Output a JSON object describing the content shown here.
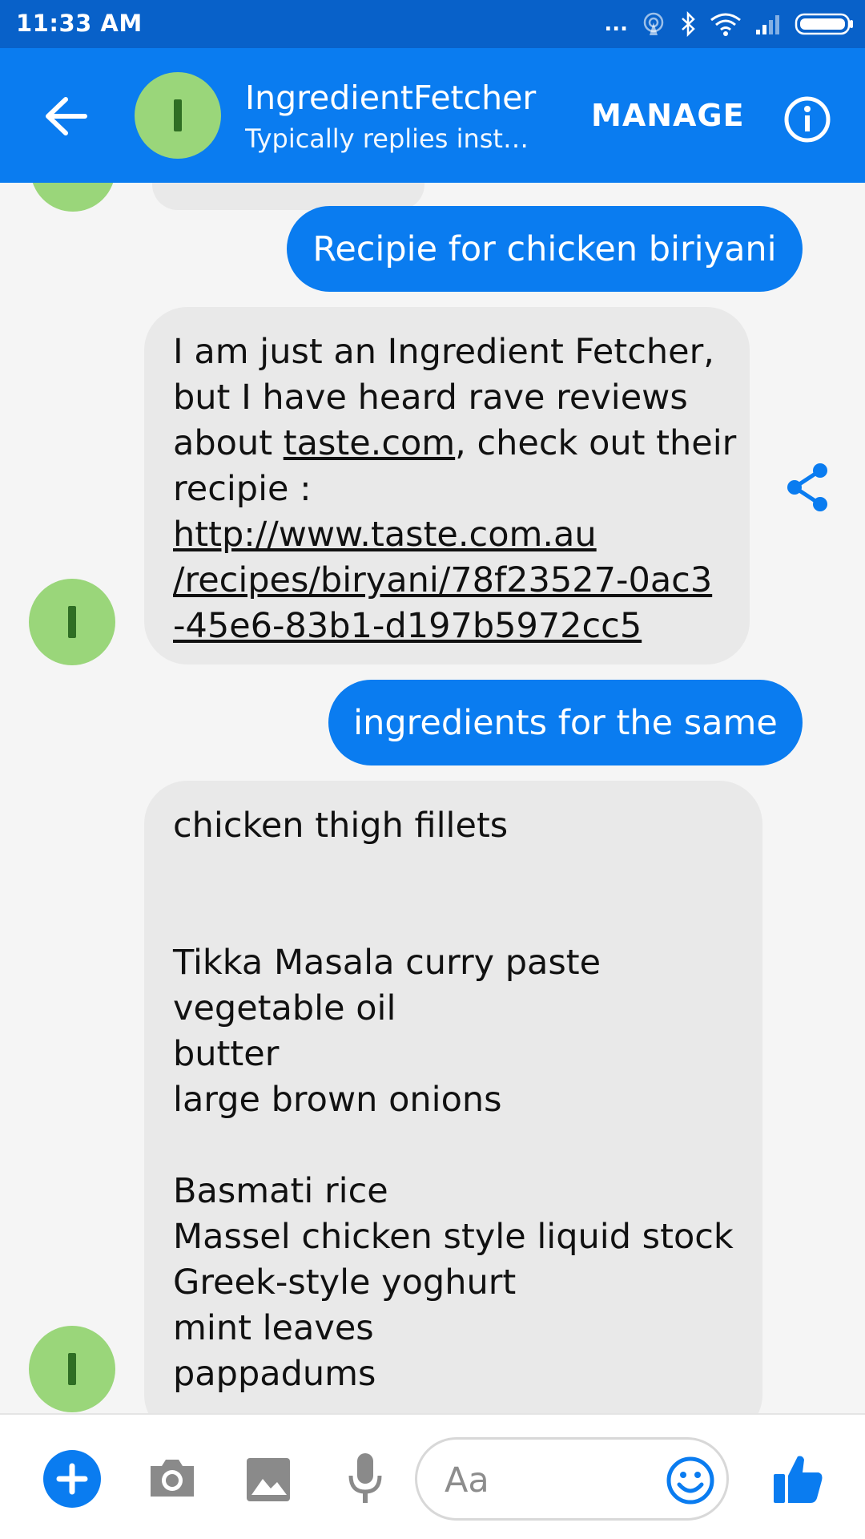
{
  "status_bar": {
    "time": "11:33 AM",
    "dots": "..."
  },
  "header": {
    "title": "IngredientFetcher",
    "subtitle": "Typically replies instantly",
    "manage_label": "MANAGE"
  },
  "messages": {
    "m1": {
      "text": "Recipie for chicken biriyani"
    },
    "m2": {
      "line1": "I am just an Ingredient Fetcher,",
      "line2": "but I have heard rave reviews",
      "line3_prefix": "about ",
      "line3_link": "taste.com",
      "line3_suffix": ", check out their",
      "line4": "recipie :",
      "url1": "http://www.taste.com.au",
      "url2": "/recipes/biryani/78f23527-0ac3",
      "url3": "-45e6-83b1-d197b5972cc5"
    },
    "m3": {
      "text": "ingredients for the same"
    },
    "m4": {
      "i1": "chicken thigh fillets",
      "i2": "Tikka Masala curry paste",
      "i3": "vegetable oil",
      "i4": "butter",
      "i5": "large brown onions",
      "i6": "Basmati rice",
      "i7": "Massel chicken style liquid stock",
      "i8": "Greek-style yoghurt",
      "i9": "mint leaves",
      "i10": "pappadums"
    }
  },
  "composer": {
    "placeholder": "Aa"
  },
  "colors": {
    "brand": "#0a7cf0",
    "status_bar": "#0861c9",
    "avatar": "#9ad67a",
    "incoming_bubble": "#e9e9e9"
  }
}
